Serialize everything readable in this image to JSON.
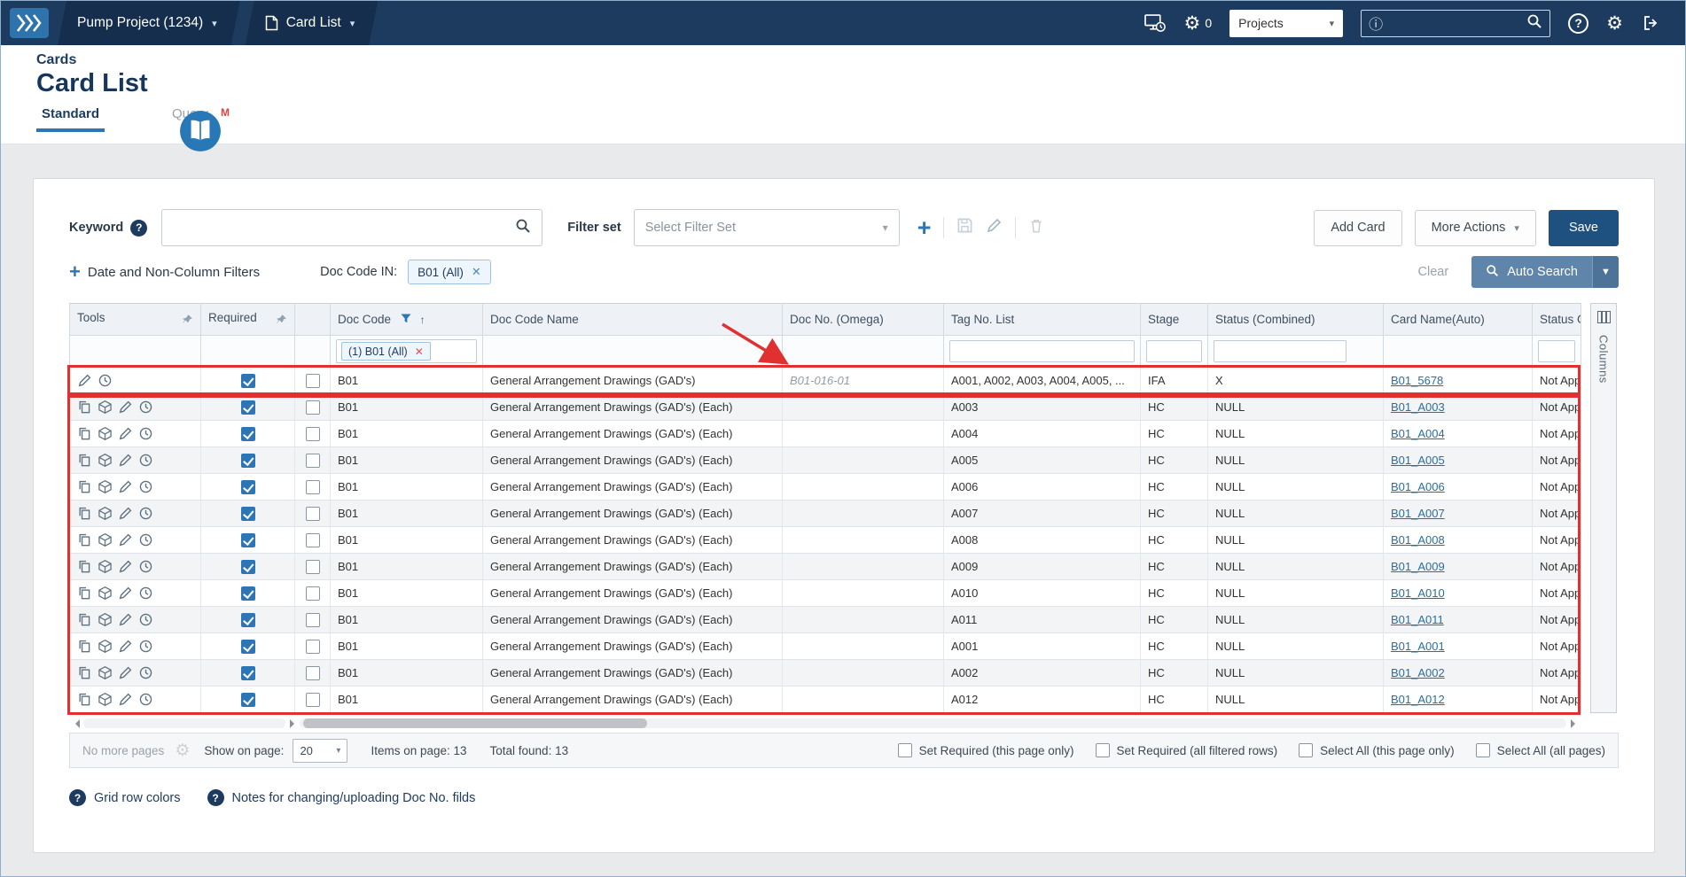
{
  "topbar": {
    "project": "Pump Project (1234)",
    "section": "Card List",
    "jobs_count": "0",
    "projects_label": "Projects"
  },
  "header": {
    "category": "Cards",
    "title": "Card List",
    "book_badge": "M",
    "tabs": [
      {
        "label": "Standard"
      },
      {
        "label": "Query"
      }
    ]
  },
  "controls": {
    "keyword_label": "Keyword",
    "filter_set_label": "Filter set",
    "filter_set_value": "Select Filter Set",
    "add_card": "Add Card",
    "more_actions": "More Actions",
    "save": "Save",
    "date_filters_link": "Date and Non-Column Filters",
    "doc_code_in_label": "Doc Code IN:",
    "doc_code_chip": "B01 (All)",
    "clear": "Clear",
    "auto_search": "Auto Search"
  },
  "table": {
    "columns": [
      "Tools",
      "Required",
      "",
      "Doc Code",
      "Doc Code Name",
      "Doc No. (Omega)",
      "Tag No. List",
      "Stage",
      "Status (Combined)",
      "Card Name(Auto)",
      "Status G"
    ],
    "filter_chip": "(1) B01 (All)",
    "columns_panel_label": "Columns",
    "rows": [
      {
        "tools": [
          "edit",
          "history"
        ],
        "required": true,
        "doc_code": "B01",
        "doc_code_name": "General Arrangement Drawings (GAD's)",
        "doc_no": "B01-016-01",
        "tag_no": "A001, A002, A003, A004, A005, ...",
        "stage": "IFA",
        "status": "X",
        "card_name": "B01_5678",
        "status_g": "Not App"
      },
      {
        "tools": [
          "copy",
          "model",
          "edit",
          "history"
        ],
        "required": true,
        "doc_code": "B01",
        "doc_code_name": "General Arrangement Drawings (GAD's) (Each)",
        "doc_no": "",
        "tag_no": "A003",
        "stage": "HC",
        "status": "NULL",
        "card_name": "B01_A003",
        "status_g": "Not App"
      },
      {
        "tools": [
          "copy",
          "model",
          "edit",
          "history"
        ],
        "required": true,
        "doc_code": "B01",
        "doc_code_name": "General Arrangement Drawings (GAD's) (Each)",
        "doc_no": "",
        "tag_no": "A004",
        "stage": "HC",
        "status": "NULL",
        "card_name": "B01_A004",
        "status_g": "Not App"
      },
      {
        "tools": [
          "copy",
          "model",
          "edit",
          "history"
        ],
        "required": true,
        "doc_code": "B01",
        "doc_code_name": "General Arrangement Drawings (GAD's) (Each)",
        "doc_no": "",
        "tag_no": "A005",
        "stage": "HC",
        "status": "NULL",
        "card_name": "B01_A005",
        "status_g": "Not App"
      },
      {
        "tools": [
          "copy",
          "model",
          "edit",
          "history"
        ],
        "required": true,
        "doc_code": "B01",
        "doc_code_name": "General Arrangement Drawings (GAD's) (Each)",
        "doc_no": "",
        "tag_no": "A006",
        "stage": "HC",
        "status": "NULL",
        "card_name": "B01_A006",
        "status_g": "Not App"
      },
      {
        "tools": [
          "copy",
          "model",
          "edit",
          "history"
        ],
        "required": true,
        "doc_code": "B01",
        "doc_code_name": "General Arrangement Drawings (GAD's) (Each)",
        "doc_no": "",
        "tag_no": "A007",
        "stage": "HC",
        "status": "NULL",
        "card_name": "B01_A007",
        "status_g": "Not App"
      },
      {
        "tools": [
          "copy",
          "model",
          "edit",
          "history"
        ],
        "required": true,
        "doc_code": "B01",
        "doc_code_name": "General Arrangement Drawings (GAD's) (Each)",
        "doc_no": "",
        "tag_no": "A008",
        "stage": "HC",
        "status": "NULL",
        "card_name": "B01_A008",
        "status_g": "Not App"
      },
      {
        "tools": [
          "copy",
          "model",
          "edit",
          "history"
        ],
        "required": true,
        "doc_code": "B01",
        "doc_code_name": "General Arrangement Drawings (GAD's) (Each)",
        "doc_no": "",
        "tag_no": "A009",
        "stage": "HC",
        "status": "NULL",
        "card_name": "B01_A009",
        "status_g": "Not App"
      },
      {
        "tools": [
          "copy",
          "model",
          "edit",
          "history"
        ],
        "required": true,
        "doc_code": "B01",
        "doc_code_name": "General Arrangement Drawings (GAD's) (Each)",
        "doc_no": "",
        "tag_no": "A010",
        "stage": "HC",
        "status": "NULL",
        "card_name": "B01_A010",
        "status_g": "Not App"
      },
      {
        "tools": [
          "copy",
          "model",
          "edit",
          "history"
        ],
        "required": true,
        "doc_code": "B01",
        "doc_code_name": "General Arrangement Drawings (GAD's) (Each)",
        "doc_no": "",
        "tag_no": "A011",
        "stage": "HC",
        "status": "NULL",
        "card_name": "B01_A011",
        "status_g": "Not App"
      },
      {
        "tools": [
          "copy",
          "model",
          "edit",
          "history"
        ],
        "required": true,
        "doc_code": "B01",
        "doc_code_name": "General Arrangement Drawings (GAD's) (Each)",
        "doc_no": "",
        "tag_no": "A001",
        "stage": "HC",
        "status": "NULL",
        "card_name": "B01_A001",
        "status_g": "Not App"
      },
      {
        "tools": [
          "copy",
          "model",
          "edit",
          "history"
        ],
        "required": true,
        "doc_code": "B01",
        "doc_code_name": "General Arrangement Drawings (GAD's) (Each)",
        "doc_no": "",
        "tag_no": "A002",
        "stage": "HC",
        "status": "NULL",
        "card_name": "B01_A002",
        "status_g": "Not App"
      },
      {
        "tools": [
          "copy",
          "model",
          "edit",
          "history"
        ],
        "required": true,
        "doc_code": "B01",
        "doc_code_name": "General Arrangement Drawings (GAD's) (Each)",
        "doc_no": "",
        "tag_no": "A012",
        "stage": "HC",
        "status": "NULL",
        "card_name": "B01_A012",
        "status_g": "Not App"
      }
    ]
  },
  "footer": {
    "no_more_pages": "No more pages",
    "show_on_page": "Show on page:",
    "page_size": "20",
    "items_on_page": "Items on page: 13",
    "total_found": "Total found: 13",
    "options": [
      "Set Required (this page only)",
      "Set Required (all filtered rows)",
      "Select All (this page only)",
      "Select All (all pages)"
    ]
  },
  "help_links": [
    {
      "label": "Grid row colors"
    },
    {
      "label": "Notes for changing/uploading Doc No. filds"
    }
  ],
  "colors": {
    "annotation": "#e03030",
    "accent": "#2e75b6",
    "topbar": "#1d3a5f"
  }
}
